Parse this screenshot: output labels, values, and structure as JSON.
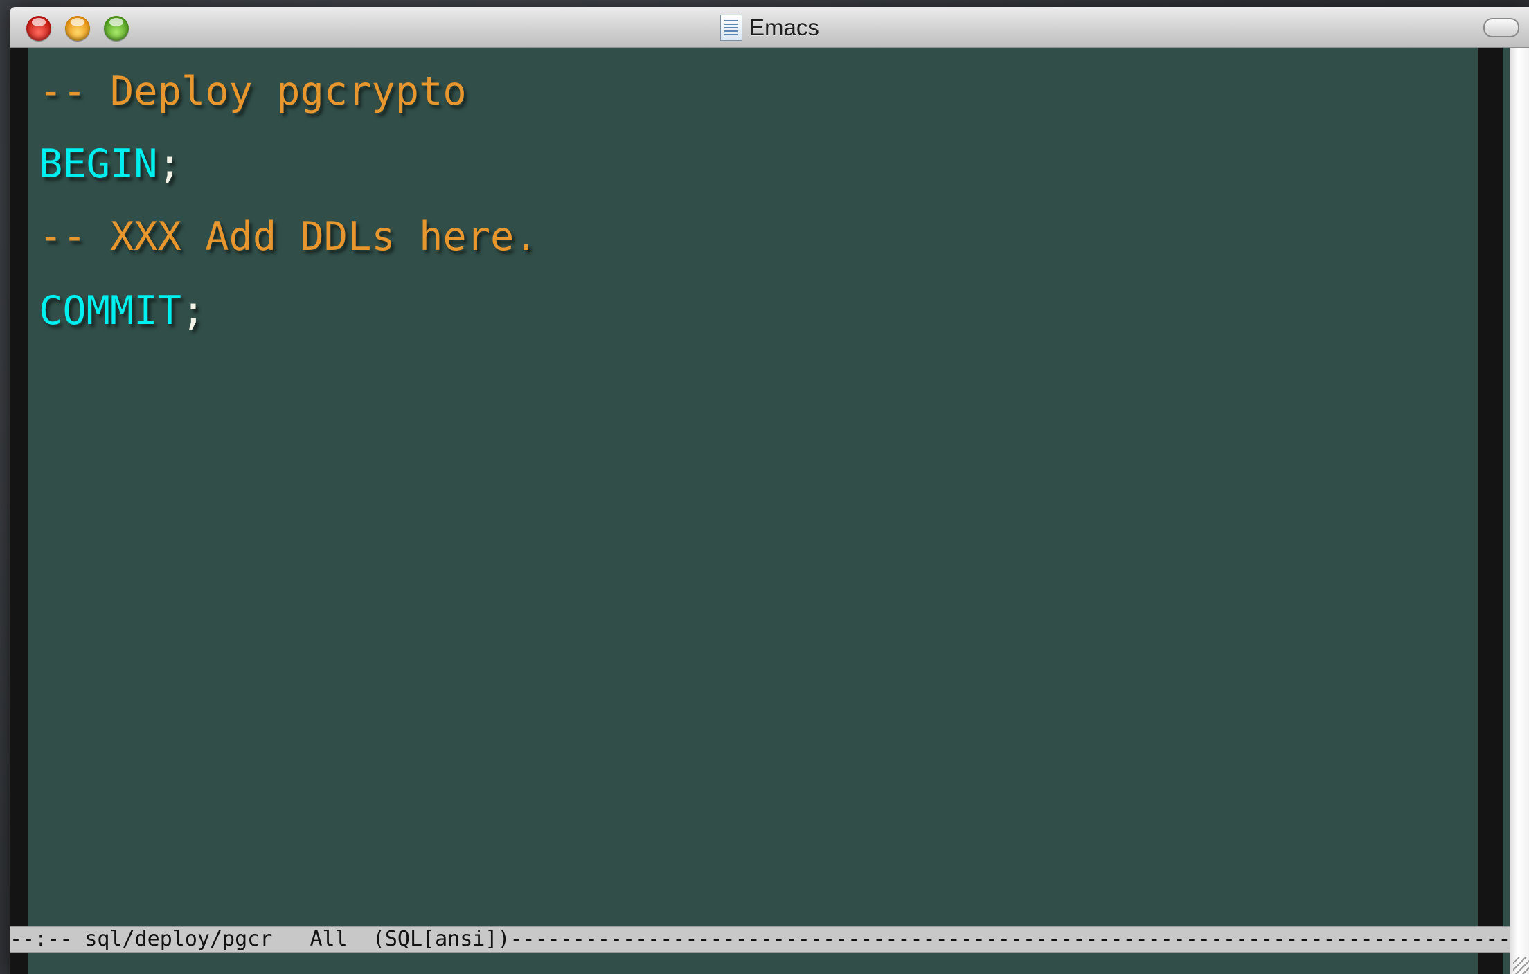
{
  "window": {
    "title": "Emacs"
  },
  "buffer": {
    "lines": {
      "comment_deploy": "-- Deploy pgcrypto",
      "begin_keyword": "BEGIN",
      "begin_semicolon": ";",
      "comment_todo": "-- XXX Add DDLs here.",
      "commit_keyword": "COMMIT",
      "commit_semicolon": ";"
    }
  },
  "modeline": {
    "status": "--:--",
    "buffer_name": "sql/deploy/pgcr",
    "position": "All",
    "mode": "(SQL[ansi])",
    "filler": "-----------------------------------------------------------------------------------------------------------"
  },
  "colors": {
    "editor_background": "#314e48",
    "comment": "#e8962e",
    "keyword": "#00f0f0",
    "punctuation": "#f2f2e6",
    "modeline_background": "#c8c8c8"
  }
}
